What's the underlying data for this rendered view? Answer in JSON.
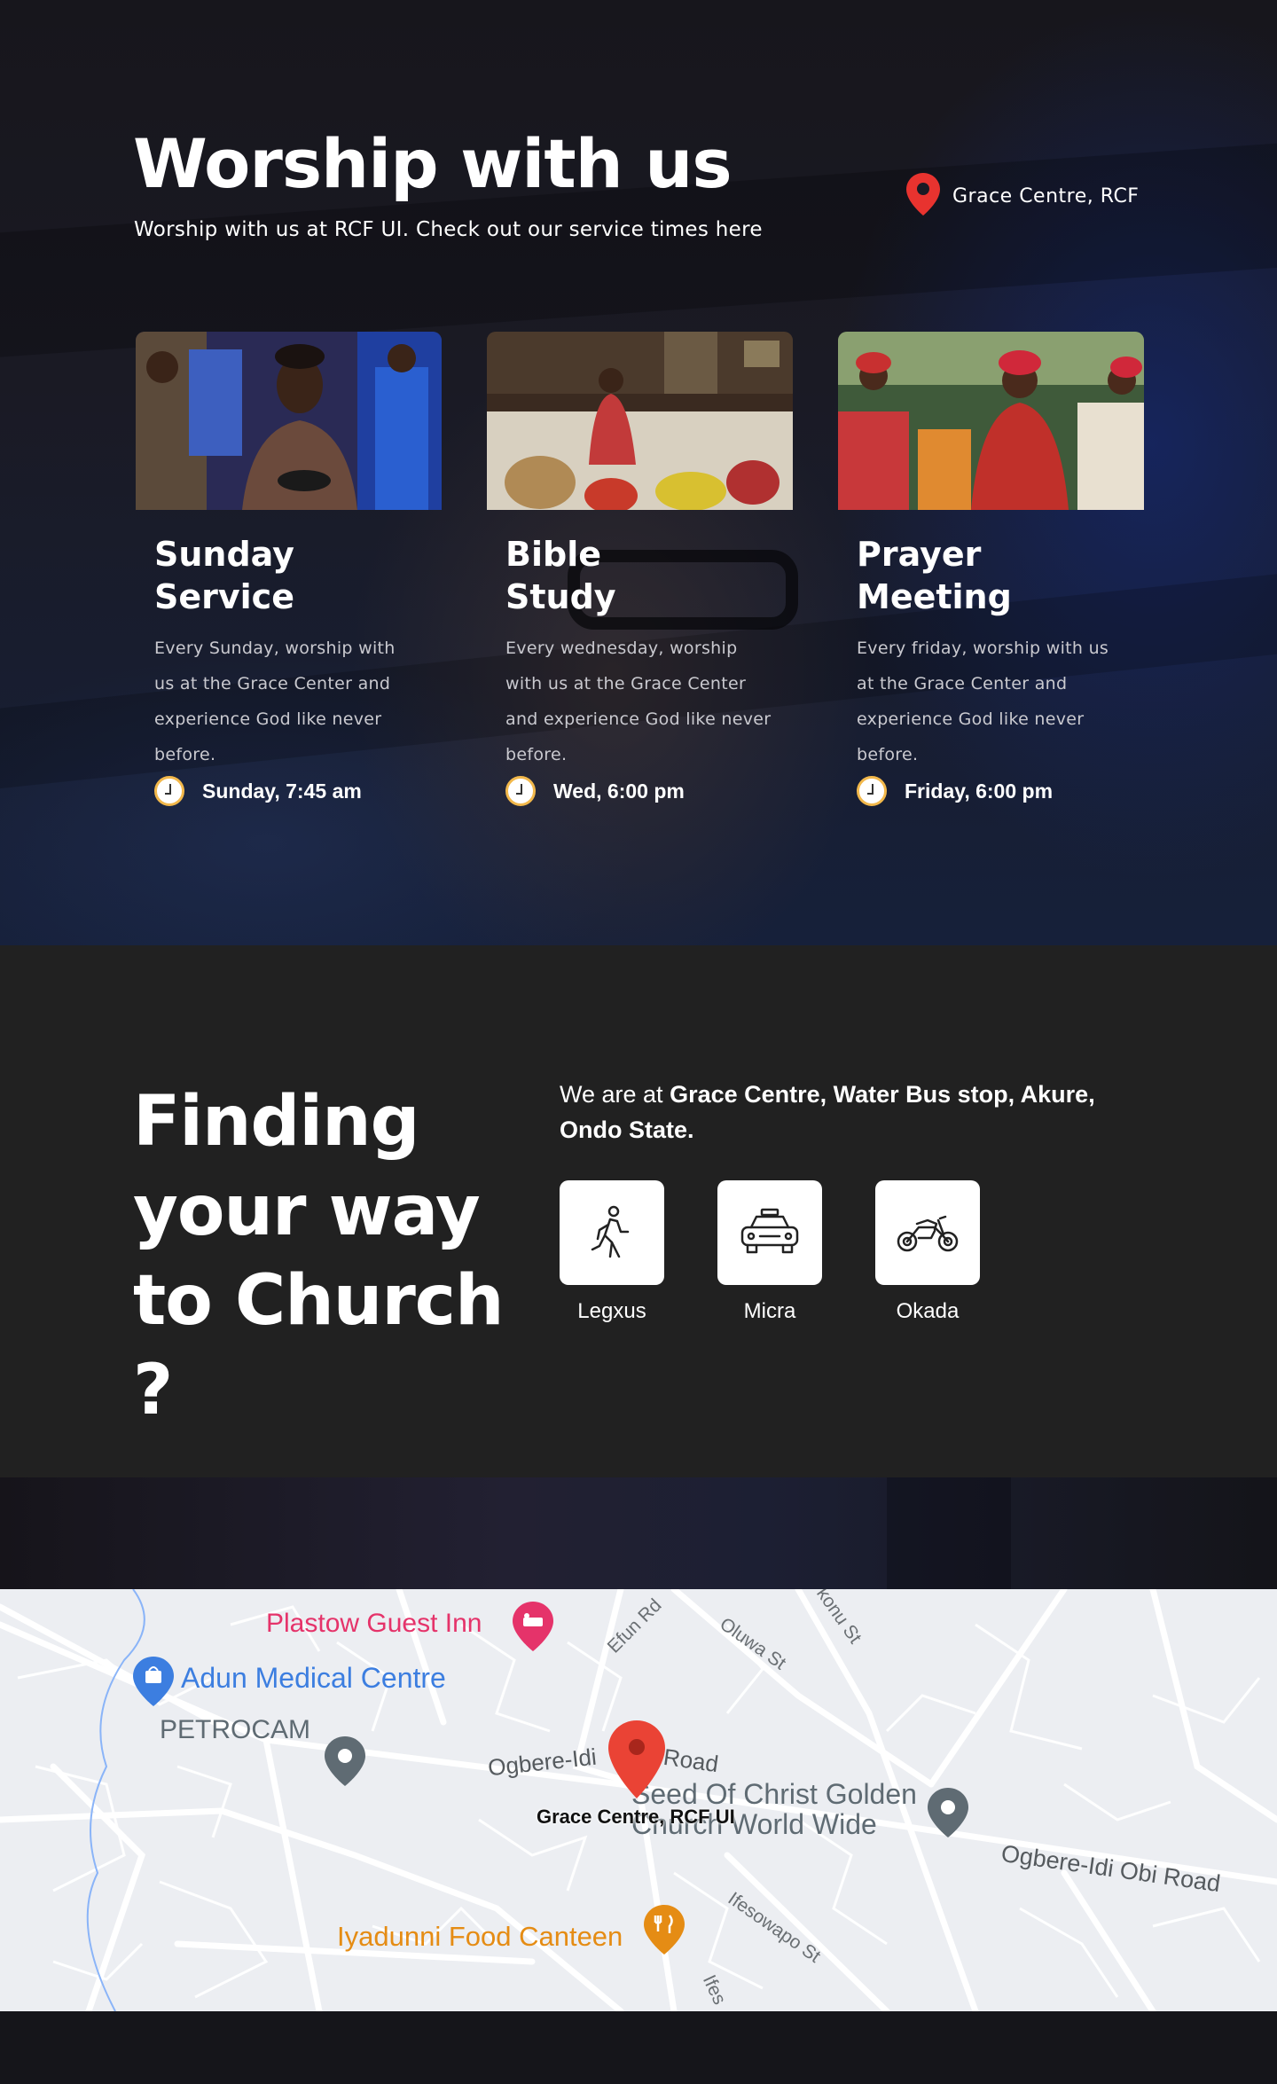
{
  "worship": {
    "title": "Worship with us",
    "subtitle": "Worship with us at RCF UI. Check out our service times here",
    "location": "Grace Centre, RCF",
    "services": [
      {
        "title": "Sunday Service",
        "description": "Every Sunday, worship with us at the Grace Center and experience God like never before.",
        "time": "Sunday, 7:45 am"
      },
      {
        "title": "Bible Study",
        "description": "Every wednesday, worship with us at the Grace Center and experience God like never before.",
        "time": "Wed, 6:00 pm"
      },
      {
        "title": "Prayer Meeting",
        "description": "Every friday, worship with us at the Grace Center and experience God like never before.",
        "time": "Friday, 6:00 pm"
      }
    ]
  },
  "directions": {
    "title": "Finding your way to Church ?",
    "address_prefix": "We are at ",
    "address_bold": "Grace Centre, Water Bus stop, Akure, Ondo State.",
    "transport": [
      {
        "label": "Legxus",
        "icon": "walking-person-icon"
      },
      {
        "label": "Micra",
        "icon": "car-icon"
      },
      {
        "label": "Okada",
        "icon": "motorcycle-icon"
      }
    ]
  },
  "map": {
    "pin_label": "Grace Centre, RCF UI",
    "places": [
      {
        "name": "Plastow Guest Inn",
        "icon": "hotel-pin-icon",
        "color": "#e5336a"
      },
      {
        "name": "Adun Medical Centre",
        "icon": "shopping-pin-icon",
        "color": "#3c7ee0"
      },
      {
        "name": "PETROCAM",
        "icon": "place-pin-icon",
        "color": "#5f6b73"
      },
      {
        "name": "Seed Of Christ Golden Church World Wide",
        "icon": "place-pin-icon",
        "color": "#5f6b73"
      },
      {
        "name": "Iyadunni Food Canteen",
        "icon": "restaurant-pin-icon",
        "color": "#e58c14"
      }
    ],
    "roads": [
      "Efun Rd",
      "Oluwa St",
      "konu St",
      "Ogbere-Idi",
      "Road",
      "Ogbere-Idi Obi Road",
      "Ifesowapo St",
      "Ifes"
    ]
  },
  "colors": {
    "accent_red": "#e8332f",
    "clock_ring": "#f2b84b",
    "dark_section": "#212121"
  }
}
